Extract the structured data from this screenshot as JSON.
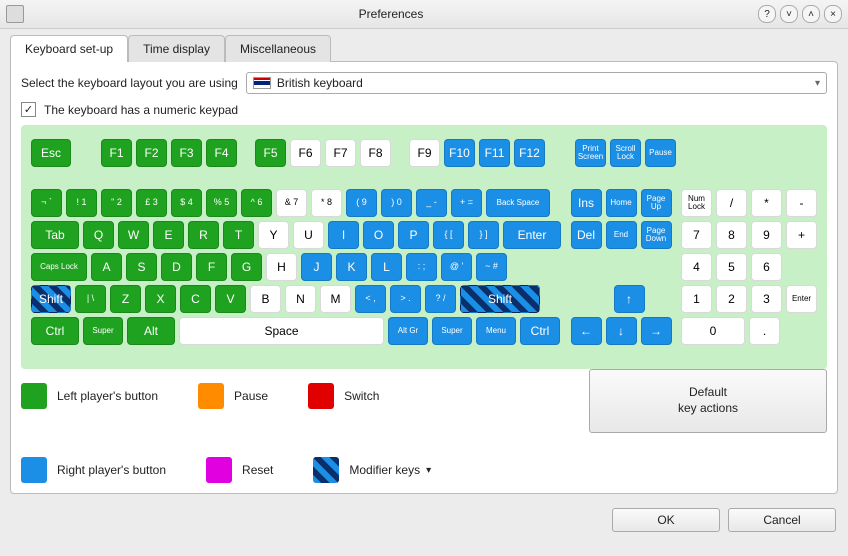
{
  "window": {
    "title": "Preferences"
  },
  "tabs": {
    "keyboard": "Keyboard set-up",
    "time": "Time display",
    "misc": "Miscellaneous"
  },
  "layout": {
    "prompt": "Select the keyboard layout you are using",
    "selected": "British keyboard",
    "numpad_label": "The keyboard has a numeric keypad"
  },
  "keys": {
    "esc": "Esc",
    "f1": "F1",
    "f2": "F2",
    "f3": "F3",
    "f4": "F4",
    "f5": "F5",
    "f6": "F6",
    "f7": "F7",
    "f8": "F8",
    "f9": "F9",
    "f10": "F10",
    "f11": "F11",
    "f12": "F12",
    "print": "Print Screen",
    "scroll": "Scroll Lock",
    "pause": "Pause",
    "backspace": "Back Space",
    "ins": "Ins",
    "home": "Home",
    "pgup": "Page Up",
    "del": "Del",
    "end": "End",
    "pgdn": "Page Down",
    "numlock": "Num Lock",
    "tab": "Tab",
    "caps": "Caps Lock",
    "enter": "Enter",
    "shift": "Shift",
    "ctrl": "Ctrl",
    "super": "Super",
    "alt": "Alt",
    "space": "Space",
    "altgr": "Alt Gr",
    "menu": "Menu",
    "r1": {
      "a": "¬ `",
      "b": "! 1",
      "c": "\" 2",
      "d": "£ 3",
      "e": "$ 4",
      "f": "% 5",
      "g": "^ 6",
      "h": "& 7",
      "i": "* 8",
      "j": "( 9",
      "k": ") 0",
      "l": "_ -",
      "m": "+ ="
    },
    "r2": {
      "a": "Q",
      "b": "W",
      "c": "E",
      "d": "R",
      "e": "T",
      "f": "Y",
      "g": "U",
      "h": "I",
      "i": "O",
      "j": "P",
      "k": "{ [",
      "l": "} ]"
    },
    "r3": {
      "a": "A",
      "b": "S",
      "c": "D",
      "d": "F",
      "e": "G",
      "f": "H",
      "g": "J",
      "h": "K",
      "i": "L",
      "j": ": ;",
      "k": "@ '",
      "l": "~ #"
    },
    "r4": {
      "a": "| \\",
      "b": "Z",
      "c": "X",
      "d": "C",
      "e": "V",
      "f": "B",
      "g": "N",
      "h": "M",
      "i": "< ,",
      "j": "> .",
      "k": "? /"
    },
    "num": {
      "slash": "/",
      "star": "*",
      "minus": "-",
      "plus": "+",
      "n7": "7",
      "n8": "8",
      "n9": "9",
      "n4": "4",
      "n5": "5",
      "n6": "6",
      "n1": "1",
      "n2": "2",
      "n3": "3",
      "n0": "0",
      "dot": ".",
      "enter": "Enter"
    },
    "arrows": {
      "up": "↑",
      "left": "←",
      "down": "↓",
      "right": "→"
    }
  },
  "legend": {
    "left": "Left player's button",
    "right": "Right player's button",
    "pause": "Pause",
    "reset": "Reset",
    "switch": "Switch",
    "mod": "Modifier keys"
  },
  "buttons": {
    "default": "Default\nkey actions",
    "ok": "OK",
    "cancel": "Cancel"
  }
}
